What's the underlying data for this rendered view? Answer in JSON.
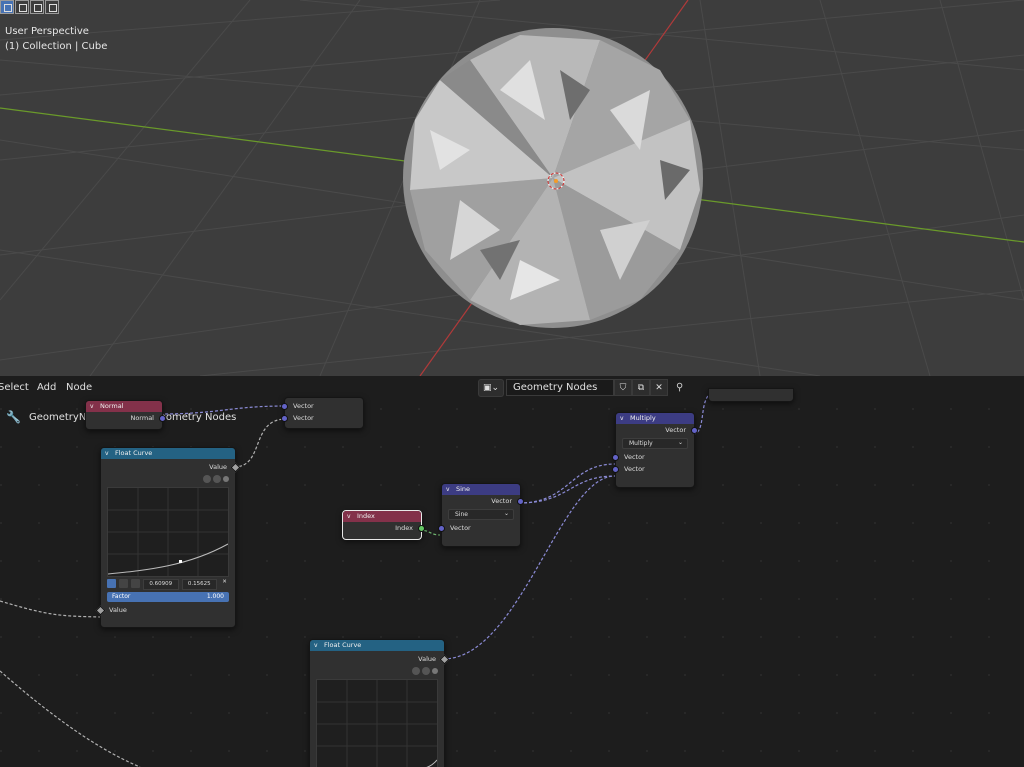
{
  "viewport": {
    "perspective_label": "User Perspective",
    "collection_label": "(1) Collection | Cube"
  },
  "node_editor": {
    "menu": [
      "Select",
      "Add",
      "Node"
    ],
    "tree_name": "Geometry Nodes",
    "breadcrumb": {
      "modifier": "GeometryNodes",
      "tree": "Geometry Nodes"
    }
  },
  "nodes": {
    "normal": {
      "title": "Normal",
      "output": "Normal"
    },
    "vector_reroute": {
      "in1": "Vector",
      "in2": "Vector"
    },
    "float_curve_1": {
      "title": "Float Curve",
      "output": "Value",
      "point_x": "0.60909",
      "point_y": "0.15625",
      "factor_label": "Factor",
      "factor_value": "1.000",
      "input": "Value"
    },
    "index": {
      "title": "Index",
      "output": "Index"
    },
    "sine": {
      "title": "Sine",
      "output": "Vector",
      "operation": "Sine",
      "input": "Vector"
    },
    "multiply": {
      "title": "Multiply",
      "output": "Vector",
      "operation": "Multiply",
      "in1": "Vector",
      "in2": "Vector"
    },
    "float_curve_2": {
      "title": "Float Curve",
      "output": "Value"
    }
  },
  "colors": {
    "input_header": "#83314a",
    "converter_header": "#246283",
    "vector_header": "#3c3c83",
    "x_axis": "#b03a3a",
    "y_axis": "#6a9a2a"
  }
}
